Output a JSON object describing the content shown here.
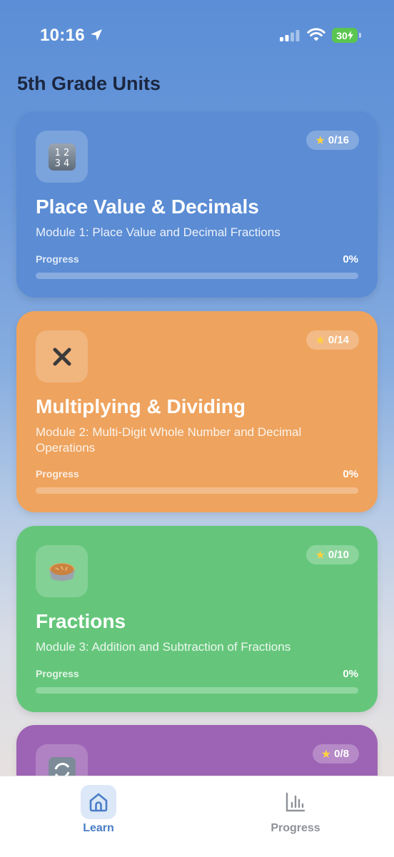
{
  "status_bar": {
    "time": "10:16",
    "battery": "30"
  },
  "page_title": "5th Grade Units",
  "units": [
    {
      "icon": "input-numbers-icon",
      "stars": "0/16",
      "title": "Place Value & Decimals",
      "subtitle": "Module 1: Place Value and Decimal Fractions",
      "progress_label": "Progress",
      "progress_value": "0%",
      "progress_fraction": 0,
      "color": "#5b8cd4"
    },
    {
      "icon": "multiply-icon",
      "stars": "0/14",
      "title": "Multiplying & Dividing",
      "subtitle": "Module 2: Multi-Digit Whole Number and Decimal Operations",
      "progress_label": "Progress",
      "progress_value": "0%",
      "progress_fraction": 0,
      "color": "#eea35e"
    },
    {
      "icon": "pie-icon",
      "stars": "0/10",
      "title": "Fractions",
      "subtitle": "Module 3: Addition and Subtraction of Fractions",
      "progress_label": "Progress",
      "progress_value": "0%",
      "progress_fraction": 0,
      "color": "#65c67b"
    },
    {
      "icon": "repeat-arrows-icon",
      "stars": "0/8",
      "color": "#9d63b4"
    }
  ],
  "tab_bar": {
    "tabs": [
      {
        "label": "Learn",
        "icon": "home-icon",
        "active": true
      },
      {
        "label": "Progress",
        "icon": "bar-chart-icon",
        "active": false
      }
    ]
  },
  "colors": {
    "accent": "#4a7dc6",
    "title_text": "#1b2740"
  }
}
